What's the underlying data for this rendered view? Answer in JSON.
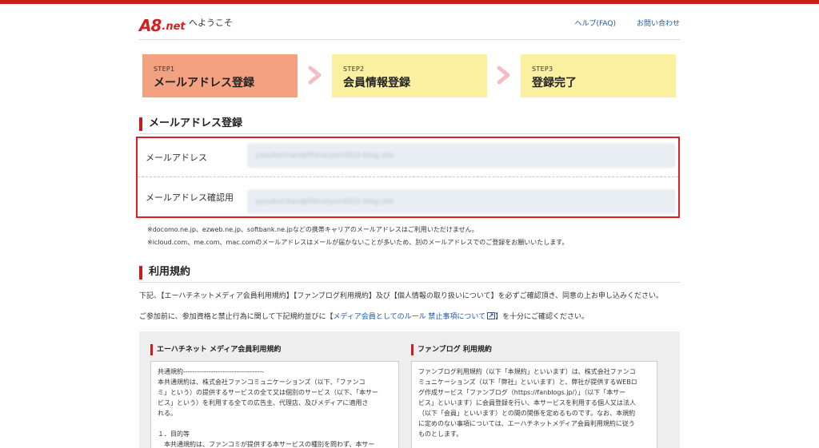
{
  "colors": {
    "brand_red": "#c81e1e",
    "step_active": "#f4a182",
    "step_inactive": "#faf0a0",
    "link": "#1a5aa8",
    "form_border": "#e02020"
  },
  "header": {
    "logo_a8": "A8",
    "logo_net": ".net",
    "welcome": "へようこそ",
    "help": "ヘルプ(FAQ)",
    "contact": "お問い合わせ"
  },
  "steps": [
    {
      "num": "STEP1",
      "label": "メールアドレス登録",
      "active": true
    },
    {
      "num": "STEP2",
      "label": "会員情報登録",
      "active": false
    },
    {
      "num": "STEP3",
      "label": "登録完了",
      "active": false
    }
  ],
  "email_section": {
    "title": "メールアドレス登録",
    "email_label": "メールアドレス",
    "email_value": "yasukoichan@fiferaryon2022-blog.site",
    "confirm_label": "メールアドレス確認用",
    "confirm_value": "yasukoichan@fiferaryon2022-blog.site",
    "note1": "※docomo.ne.jp、ezweb.ne.jp、softbank.ne.jpなどの携帯キャリアのメールアドレスはご利用いただけません。",
    "note2": "※icloud.com、me.com、mac.comのメールアドレスはメールが届かないことが多いため、別のメールアドレスでのご登録をお願いいたします。"
  },
  "terms_section": {
    "title": "利用規約",
    "intro": "下記、【エーハチネットメディア会員利用規約】【ファンブログ利用規約】及び【個人情報の取り扱いについて】を必ずご確認頂き、同意の上お申し込みください。",
    "pre_link": "ご参加前に、参加資格と禁止行為に関して下記規約並びに【",
    "link": "メディア会員としてのルール 禁止事項について",
    "post_link": "】を十分にご確認ください。",
    "left_title": "エーハチネット メディア会員利用規約",
    "left_lines": [
      "共通規約-----------------------------------",
      "本共通規約は、株式会社ファンコミュニケーションズ（以下、「ファンコ",
      "ミ」という）の提供するサービスの全て又は個別のサービス（以下、「本サー",
      "ビス」という）を利用する全ての広告主、代理店、及びメディアに適用さ",
      "れる。",
      "",
      "１．目的等",
      "　本共通規約は、ファンコミが提供する本サービスの種別を問わず、本サー"
    ],
    "right_title": "ファンブログ 利用規約",
    "right_lines": [
      "ファンブログ利用規約（以下「本規約」といいます）は、株式会社ファンコ",
      "ミュニケーションズ（以下「弊社」といいます）と、弊社が提供するWEBロ",
      "グ作成サービス「ファンブログ（https://fanblogs.jp/）」（以下「本サー",
      "ビス」といいます）に会員登録を行い、本サービスを利用する個人又は法人",
      "（以下「会員」といいます）との間の関係を定めるものです。なお、本規約",
      "に定めのない事項については、エーハチネットメディア会員利用規約に従う",
      "ものとします。"
    ]
  }
}
